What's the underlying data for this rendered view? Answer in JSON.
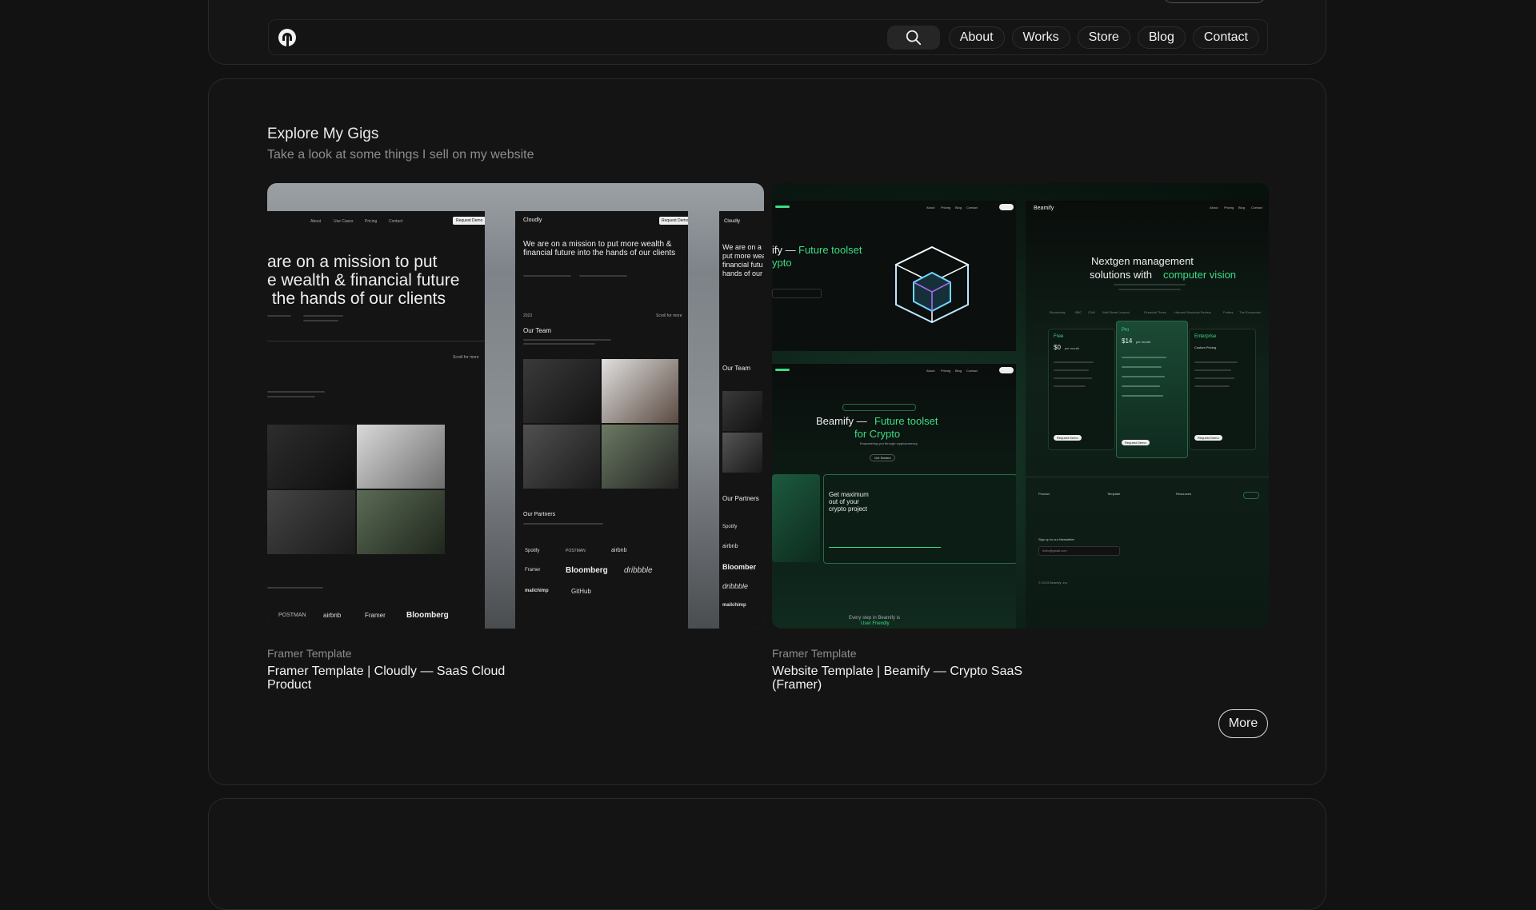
{
  "header": {
    "logo_alt": "logo",
    "search_icon": "search-icon",
    "nav_links": [
      "About",
      "Works",
      "Store",
      "Blog",
      "Contact"
    ]
  },
  "section": {
    "title": "Explore My Gigs",
    "subtitle": "Take a look at some things I sell on my website"
  },
  "cards": [
    {
      "category": "Framer Template",
      "title": "Framer Template | Cloudly — SaaS Cloud Product",
      "preview": {
        "brand": "Cloudly",
        "nav": [
          "About",
          "Use Cases",
          "Pricing",
          "Contact"
        ],
        "cta": "Request Demo",
        "headline_big": [
          "are on a mission to put",
          "e wealth & financial future",
          " the hands of our clients"
        ],
        "headline_mid": "We are on a mission to put more wealth & financial future into the hands of our clients",
        "headline_right": [
          "We are on a r",
          "put more wea",
          "financial futu",
          "hands of our"
        ],
        "scroll_label": "Scroll for more",
        "team_label": "Our Team",
        "partners_label": "Our Partners",
        "year": "2023",
        "partners": [
          "Spotify",
          "POSTMAN",
          "airbnb",
          "Framer",
          "Bloomberg",
          "dribbble",
          "mailchimp",
          "GitHub"
        ],
        "bottom_partners": [
          "POSTMAN",
          "airbnb",
          "Framer",
          "Bloomberg"
        ],
        "right_partners": [
          "Spotify",
          "airbnb",
          "Bloomber",
          "dribbble",
          "mailchimp"
        ]
      }
    },
    {
      "category": "Framer Template",
      "title": "Website Template | Beamify — Crypto SaaS (Framer)",
      "preview": {
        "brand": "Beamify",
        "nav": [
          "About",
          "Pricing",
          "Blog",
          "Contact"
        ],
        "hero_left": [
          "ify —",
          "Future toolset",
          "ypto"
        ],
        "hero_mid": [
          "Beamify —",
          "Future toolset",
          "for Crypto"
        ],
        "hero_mid_sub": "Empowering you through cryptocurrency",
        "get_started": "Get Started",
        "maximum": [
          "Get maximum",
          "out of your",
          "crypto project"
        ],
        "nextgen": [
          "Nextgen management",
          "solutions with",
          "computer vision"
        ],
        "plans": [
          {
            "name": "Free",
            "price": "$0",
            "per": "per month",
            "cta": "Request Demo"
          },
          {
            "name": "Pro",
            "price": "$14",
            "per": "per month",
            "cta": "Request Demo"
          },
          {
            "name": "Enterprise",
            "price": "Custom Pricing",
            "per": "",
            "cta": "Request Demo"
          }
        ],
        "footer_cols": [
          "Product",
          "Template",
          "Resources"
        ],
        "newsletter": "Sign up to our Newsletter",
        "email_placeholder": "hello@gmail.com",
        "copyright": "© 2023 Beamify, Inc.",
        "every_step": [
          "Every step in Beamify is",
          "User Friendly"
        ],
        "logos": [
          "Bloomberg",
          "BBC",
          "CNN",
          "Wall Street Journal",
          "Financial Times",
          "Harvard Business Review",
          "Forbes",
          "The Economist"
        ]
      }
    }
  ],
  "more_button": "More",
  "colors": {
    "background": "#121212",
    "panel": "#141414",
    "accent_green": "#3ddc84",
    "text": "#f2f2f2",
    "muted": "#8d8d8d"
  }
}
